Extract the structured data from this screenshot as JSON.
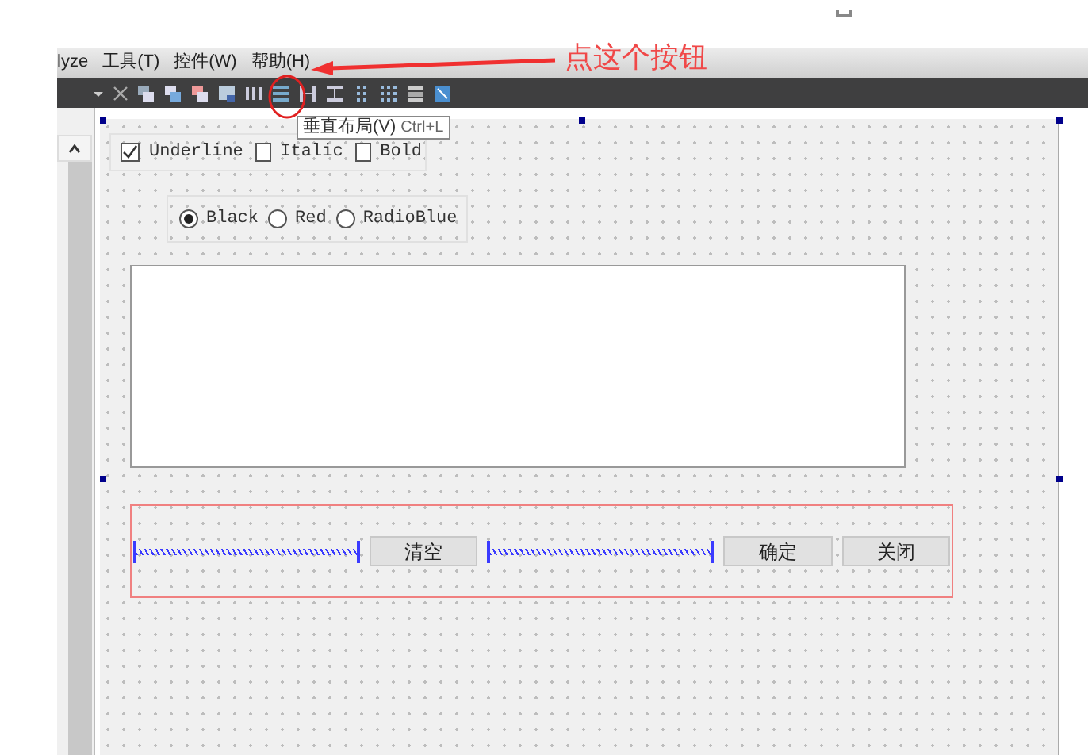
{
  "menu": [
    {
      "label": "lyze"
    },
    {
      "label": "工具(T)"
    },
    {
      "label": "控件(W)"
    },
    {
      "label": "帮助(H)"
    }
  ],
  "annotation": {
    "text": "点这个按钮"
  },
  "tooltip": {
    "text": "垂直布局(V)",
    "shortcut": "Ctrl+L"
  },
  "form": {
    "checkboxes": [
      {
        "label": "Underline",
        "checked": true
      },
      {
        "label": "Italic",
        "checked": false
      },
      {
        "label": "Bold",
        "checked": false
      }
    ],
    "radios": [
      {
        "label": "Black",
        "selected": true
      },
      {
        "label": "Red",
        "selected": false
      },
      {
        "label": "RadioBlue",
        "selected": false
      }
    ],
    "layout_items": [
      {
        "kind": "spacer"
      },
      {
        "kind": "button",
        "label": "清空"
      },
      {
        "kind": "spacer"
      },
      {
        "kind": "button",
        "label": "确定"
      },
      {
        "kind": "button",
        "label": "关闭"
      }
    ]
  }
}
